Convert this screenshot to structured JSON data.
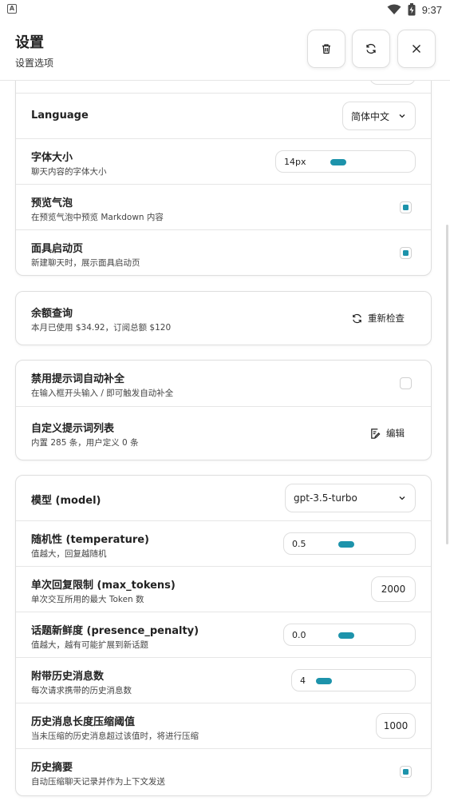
{
  "status_bar": {
    "time": "9:37",
    "icons": [
      "app-indicator-icon",
      "wifi-icon",
      "battery-icon"
    ]
  },
  "header": {
    "title": "设置",
    "subtitle": "设置选项",
    "buttons": [
      "delete-icon",
      "reset-icon",
      "close-icon"
    ]
  },
  "general": {
    "language": {
      "label": "Language",
      "value": "简体中文"
    },
    "font_size": {
      "label": "字体大小",
      "description": "聊天内容的字体大小",
      "value": "14px",
      "level": 0.42
    },
    "preview_bubble": {
      "label": "预览气泡",
      "description": "在预览气泡中预览 Markdown 内容",
      "checked": true
    },
    "mask_launcher": {
      "label": "面具启动页",
      "description": "新建聊天时，展示面具启动页",
      "checked": true
    }
  },
  "usage": {
    "label": "余额查询",
    "description": "本月已使用 $34.92，订阅总额 $120",
    "button": "重新检查"
  },
  "prompts": {
    "disable_autocomplete": {
      "label": "禁用提示词自动补全",
      "description": "在输入框开头输入 / 即可触发自动补全",
      "checked": false
    },
    "custom_list": {
      "label": "自定义提示词列表",
      "description": "内置 285 条，用户定义 0 条",
      "button": "编辑"
    }
  },
  "model": {
    "model": {
      "label": "模型 (model)",
      "value": "gpt-3.5-turbo"
    },
    "temperature": {
      "label": "随机性 (temperature)",
      "description": "值越大，回复越随机",
      "value": "0.5",
      "level": 0.5
    },
    "max_tokens": {
      "label": "单次回复限制 (max_tokens)",
      "description": "单次交互所用的最大 Token 数",
      "value": "2000"
    },
    "presence_penalty": {
      "label": "话题新鲜度 (presence_penalty)",
      "description": "值越大，越有可能扩展到新话题",
      "value": "0.0",
      "level": 0.5
    },
    "history_count": {
      "label": "附带历史消息数",
      "description": "每次请求携带的历史消息数",
      "value": "4",
      "level": 0.125
    },
    "compress_threshold": {
      "label": "历史消息长度压缩阈值",
      "description": "当未压缩的历史消息超过该值时，将进行压缩",
      "value": "1000"
    },
    "history_summary": {
      "label": "历史摘要",
      "description": "自动压缩聊天记录并作为上下文发送",
      "checked": true
    }
  },
  "colors": {
    "accent": "#1d93ab",
    "border": "#dedede"
  }
}
